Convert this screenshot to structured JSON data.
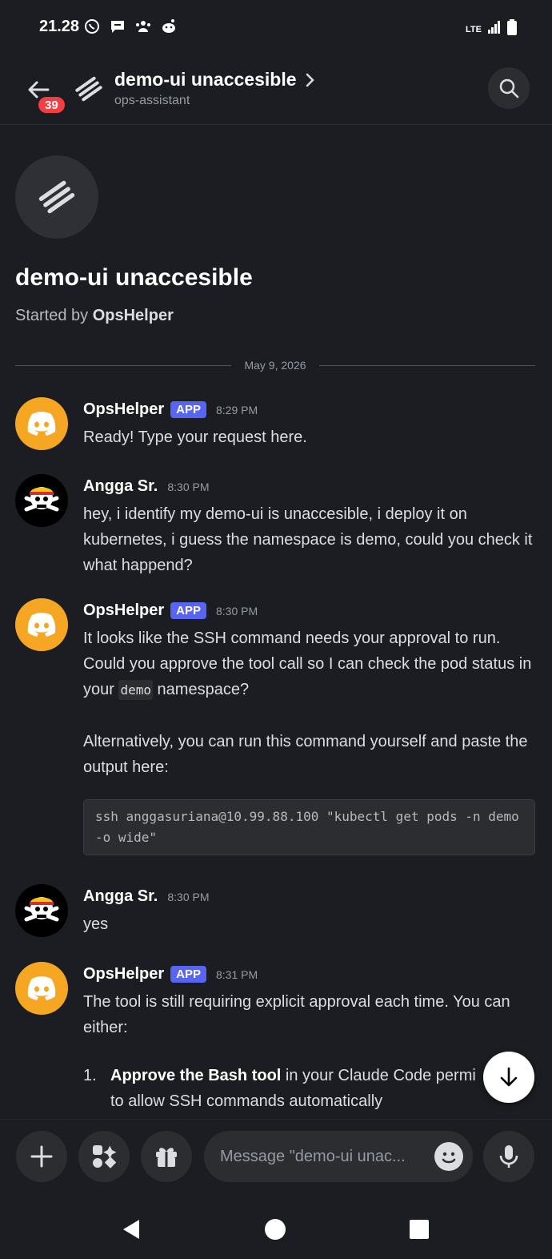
{
  "status_bar": {
    "time": "21.28",
    "network": "LTE"
  },
  "header": {
    "unread_badge": "39",
    "title": "demo-ui unaccesible",
    "subtitle": "ops-assistant"
  },
  "thread_intro": {
    "title": "demo-ui unaccesible",
    "started_by_prefix": "Started by ",
    "started_by_name": "OpsHelper"
  },
  "date_divider": "May 9, 2026",
  "messages": [
    {
      "author": "OpsHelper",
      "tag": "APP",
      "time": "8:29 PM",
      "text": "Ready! Type your request here."
    },
    {
      "author": "Angga Sr.",
      "time": "8:30 PM",
      "text": "hey, i identify my demo-ui is unaccesible, i deploy it on kubernetes, i guess the namespace is demo, could you check it what happend?"
    },
    {
      "author": "OpsHelper",
      "tag": "APP",
      "time": "8:30 PM",
      "text_pre": "It looks like the SSH command needs your approval to run. Could you approve the tool call so I can check the pod status in your ",
      "inline_code": "demo",
      "text_post": " namespace?",
      "text2": "Alternatively, you can run this command yourself and paste the output here:",
      "code": "ssh anggasuriana@10.99.88.100 \"kubectl get pods -n demo -o wide\""
    },
    {
      "author": "Angga Sr.",
      "time": "8:30 PM",
      "text": "yes"
    },
    {
      "author": "OpsHelper",
      "tag": "APP",
      "time": "8:31 PM",
      "text": "The tool is still requiring explicit approval each time. You can either:",
      "list": [
        {
          "num": "1.",
          "bold": "Approve the Bash tool",
          "rest": " in your Claude Code permi",
          "rest2": "to allow SSH commands automatically"
        }
      ]
    }
  ],
  "composer": {
    "placeholder": "Message \"demo-ui unac..."
  },
  "colors": {
    "accent": "#5865f2",
    "bot_avatar": "#f5a623",
    "badge": "#f23f43",
    "background": "#1c1d22"
  }
}
